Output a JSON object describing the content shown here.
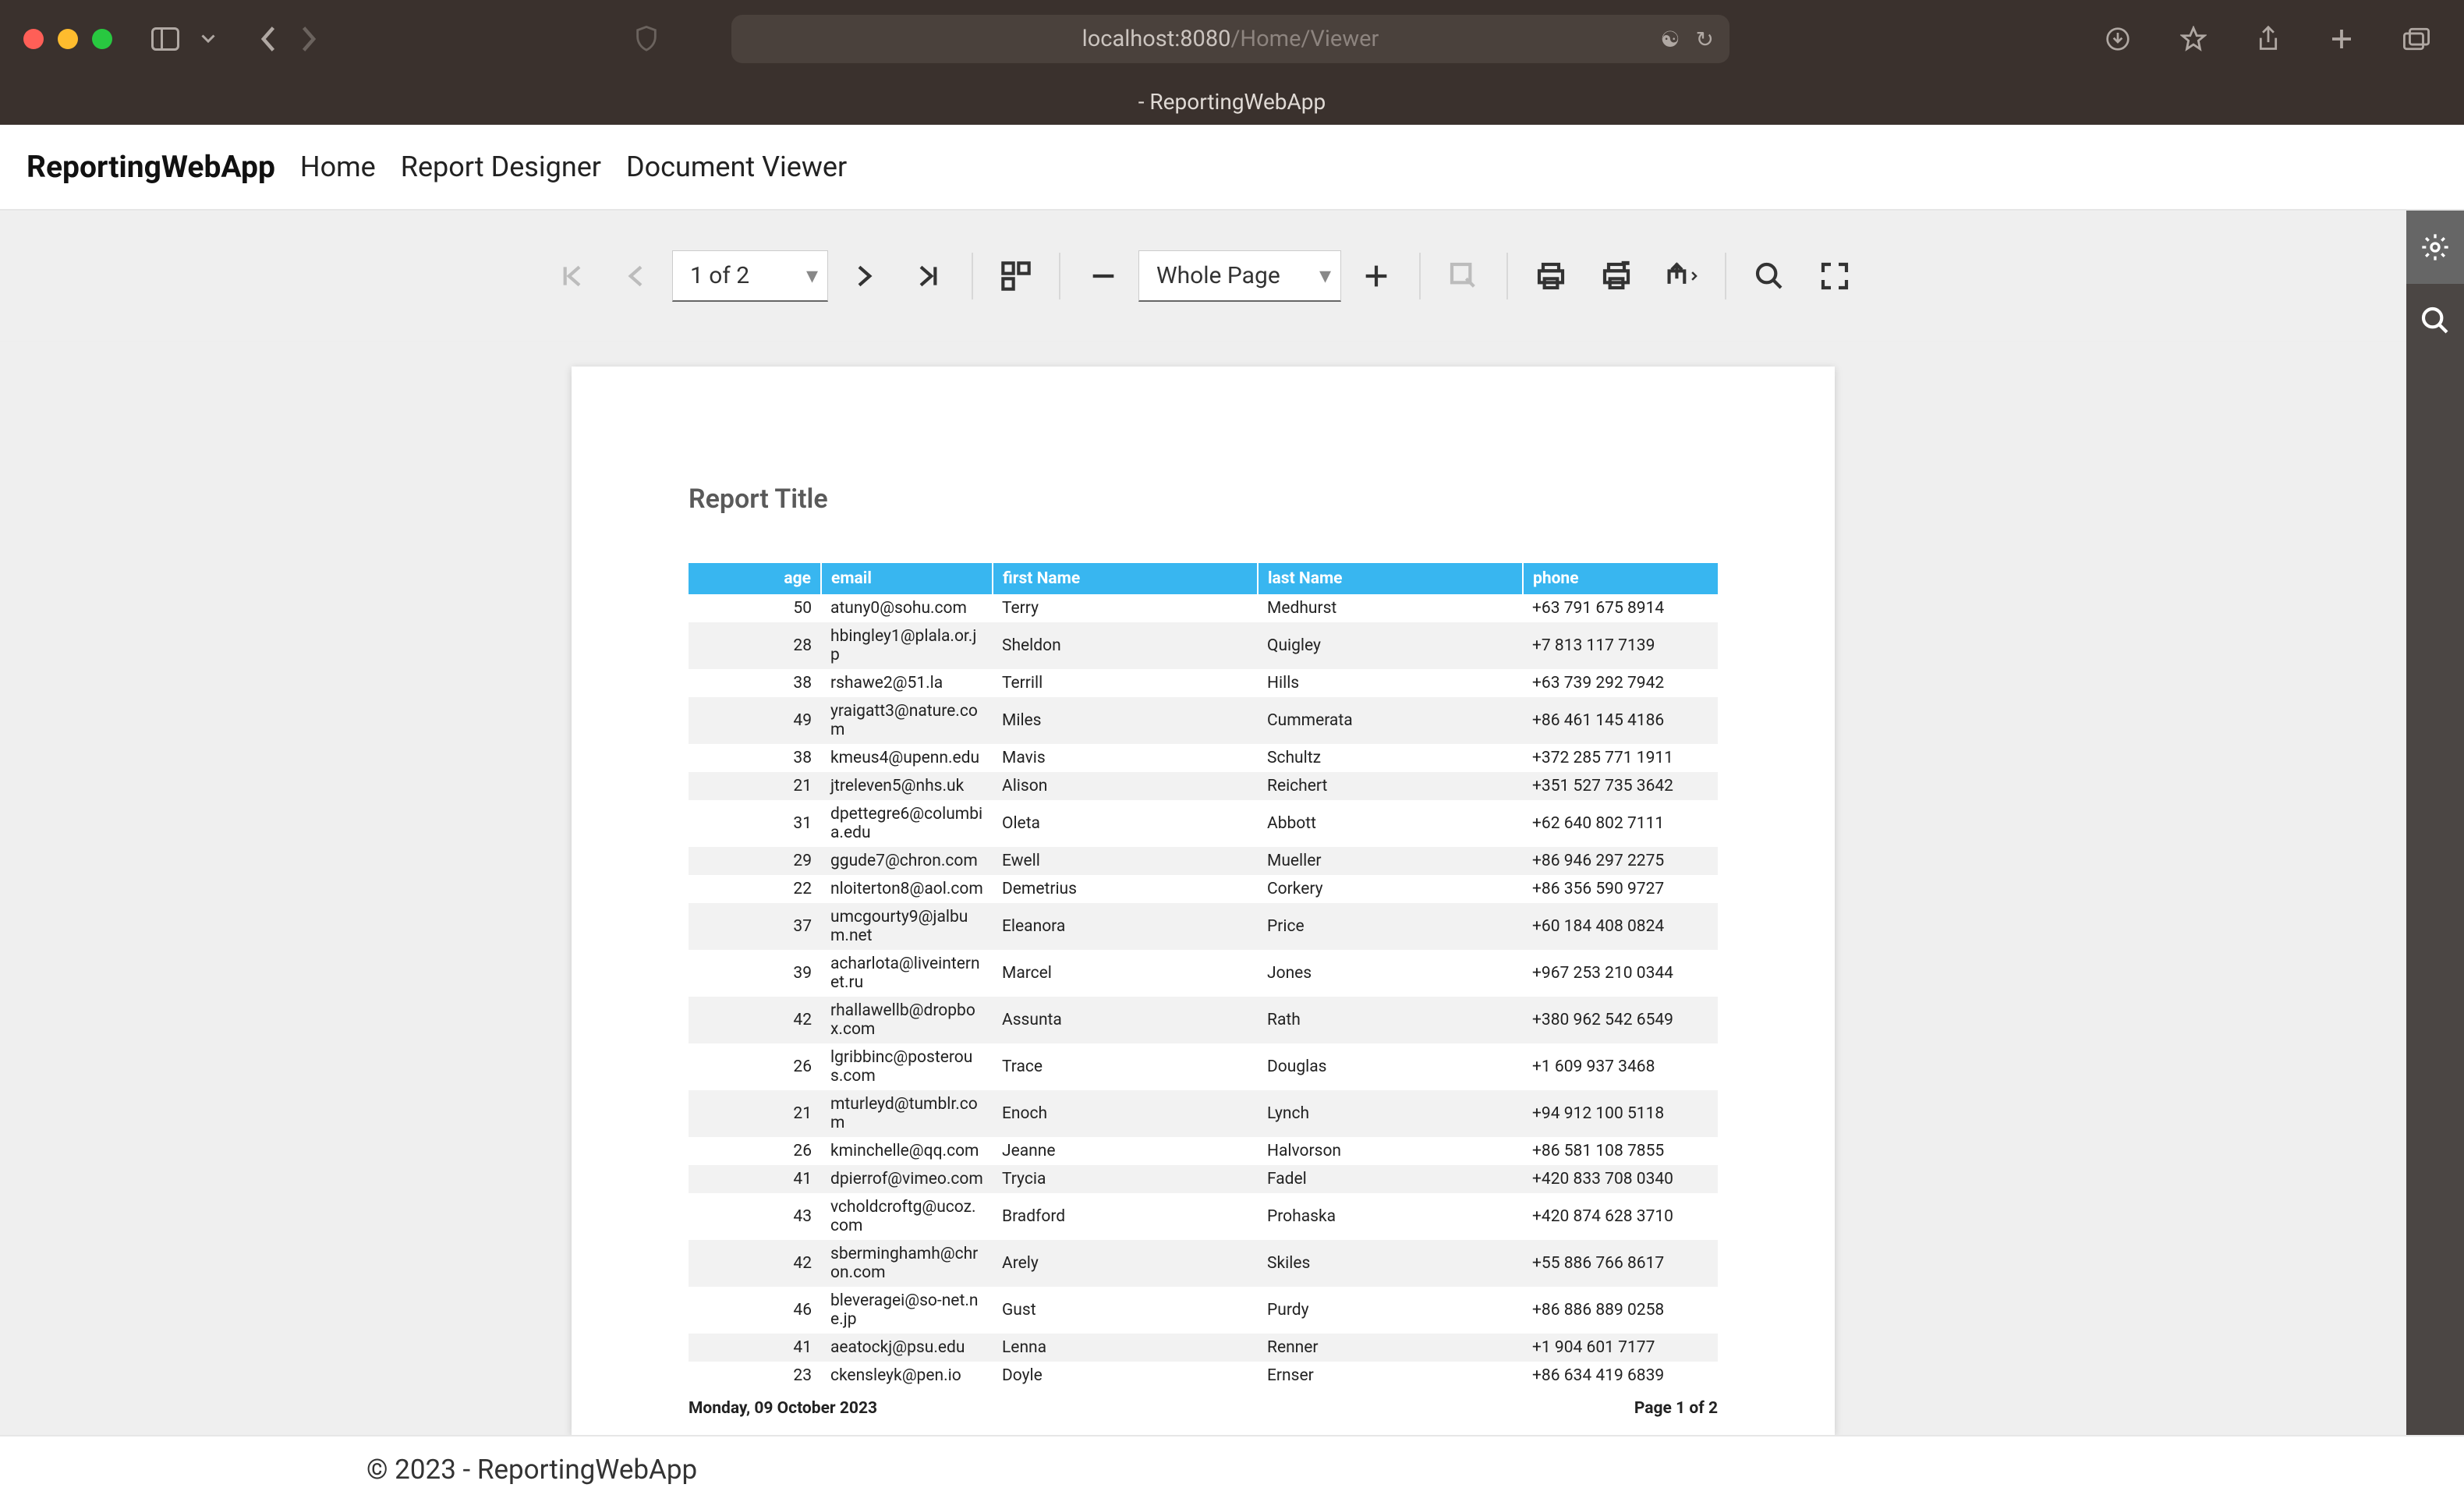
{
  "browser": {
    "url_host": "localhost:8080",
    "url_path": "/Home/Viewer",
    "tab_title": "- ReportingWebApp"
  },
  "nav": {
    "brand": "ReportingWebApp",
    "links": [
      "Home",
      "Report Designer",
      "Document Viewer"
    ]
  },
  "toolbar": {
    "page_text": "1 of 2",
    "zoom_text": "Whole Page"
  },
  "report": {
    "title": "Report Title",
    "columns": {
      "age": "age",
      "email": "email",
      "firstName": "first Name",
      "lastName": "last Name",
      "phone": "phone"
    },
    "rows": [
      {
        "age": "50",
        "email": "atuny0@sohu.com",
        "firstName": "Terry",
        "lastName": "Medhurst",
        "phone": "+63 791 675 8914"
      },
      {
        "age": "28",
        "email": "hbingley1@plala.or.jp",
        "firstName": "Sheldon",
        "lastName": "Quigley",
        "phone": "+7 813 117 7139"
      },
      {
        "age": "38",
        "email": "rshawe2@51.la",
        "firstName": "Terrill",
        "lastName": "Hills",
        "phone": "+63 739 292 7942"
      },
      {
        "age": "49",
        "email": "yraigatt3@nature.com",
        "firstName": "Miles",
        "lastName": "Cummerata",
        "phone": "+86 461 145 4186"
      },
      {
        "age": "38",
        "email": "kmeus4@upenn.edu",
        "firstName": "Mavis",
        "lastName": "Schultz",
        "phone": "+372 285 771 1911"
      },
      {
        "age": "21",
        "email": "jtreleven5@nhs.uk",
        "firstName": "Alison",
        "lastName": "Reichert",
        "phone": "+351 527 735 3642"
      },
      {
        "age": "31",
        "email": "dpettegre6@columbia.edu",
        "firstName": "Oleta",
        "lastName": "Abbott",
        "phone": "+62 640 802 7111"
      },
      {
        "age": "29",
        "email": "ggude7@chron.com",
        "firstName": "Ewell",
        "lastName": "Mueller",
        "phone": "+86 946 297 2275"
      },
      {
        "age": "22",
        "email": "nloiterton8@aol.com",
        "firstName": "Demetrius",
        "lastName": "Corkery",
        "phone": "+86 356 590 9727"
      },
      {
        "age": "37",
        "email": "umcgourty9@jalbum.net",
        "firstName": "Eleanora",
        "lastName": "Price",
        "phone": "+60 184 408 0824"
      },
      {
        "age": "39",
        "email": "acharlota@liveinternet.ru",
        "firstName": "Marcel",
        "lastName": "Jones",
        "phone": "+967 253 210 0344"
      },
      {
        "age": "42",
        "email": "rhallawellb@dropbox.com",
        "firstName": "Assunta",
        "lastName": "Rath",
        "phone": "+380 962 542 6549"
      },
      {
        "age": "26",
        "email": "lgribbinc@posterous.com",
        "firstName": "Trace",
        "lastName": "Douglas",
        "phone": "+1 609 937 3468"
      },
      {
        "age": "21",
        "email": "mturleyd@tumblr.com",
        "firstName": "Enoch",
        "lastName": "Lynch",
        "phone": "+94 912 100 5118"
      },
      {
        "age": "26",
        "email": "kminchelle@qq.com",
        "firstName": "Jeanne",
        "lastName": "Halvorson",
        "phone": "+86 581 108 7855"
      },
      {
        "age": "41",
        "email": "dpierrof@vimeo.com",
        "firstName": "Trycia",
        "lastName": "Fadel",
        "phone": "+420 833 708 0340"
      },
      {
        "age": "43",
        "email": "vcholdcroftg@ucoz.com",
        "firstName": "Bradford",
        "lastName": "Prohaska",
        "phone": "+420 874 628 3710"
      },
      {
        "age": "42",
        "email": "sberminghamh@chron.com",
        "firstName": "Arely",
        "lastName": "Skiles",
        "phone": "+55 886 766 8617"
      },
      {
        "age": "46",
        "email": "bleveragei@so-net.ne.jp",
        "firstName": "Gust",
        "lastName": "Purdy",
        "phone": "+86 886 889 0258"
      },
      {
        "age": "41",
        "email": "aeatockj@psu.edu",
        "firstName": "Lenna",
        "lastName": "Renner",
        "phone": "+1 904 601 7177"
      },
      {
        "age": "23",
        "email": "ckensleyk@pen.io",
        "firstName": "Doyle",
        "lastName": "Ernser",
        "phone": "+86 634 419 6839"
      }
    ],
    "footer_date": "Monday, 09 October 2023",
    "footer_page": "Page 1 of 2"
  },
  "footer": {
    "copyright": "© 2023 - ReportingWebApp"
  }
}
